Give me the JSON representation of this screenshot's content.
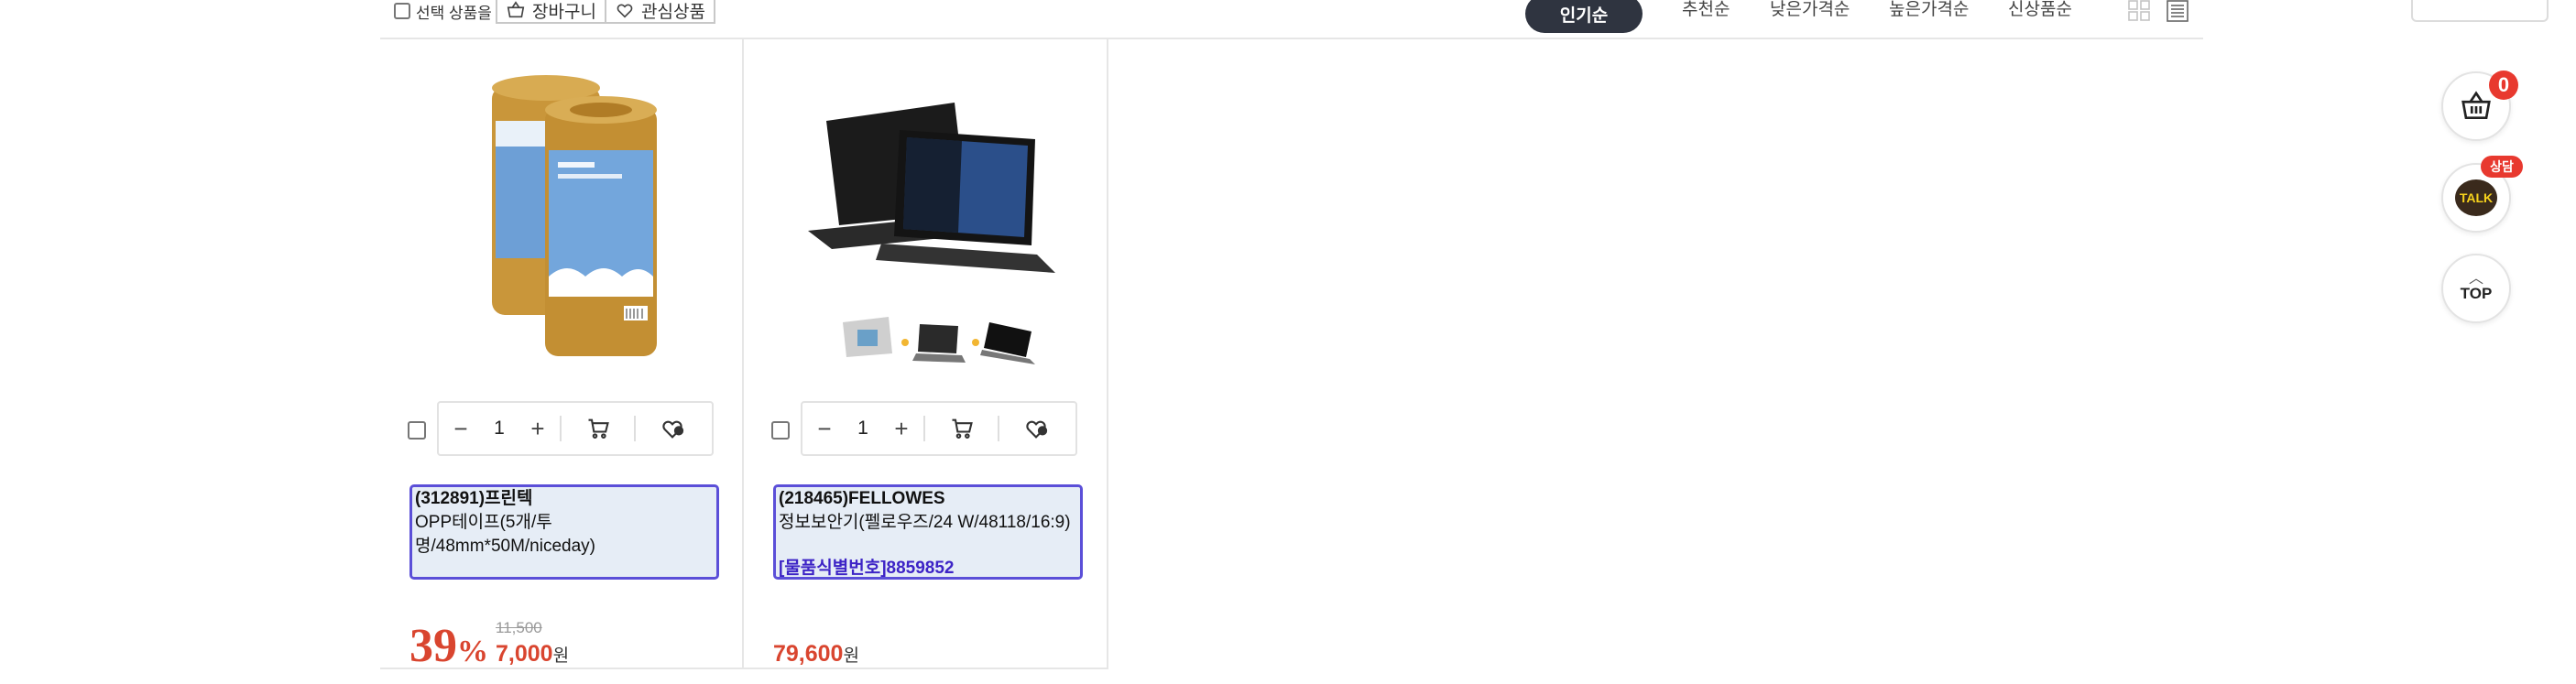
{
  "toolbar": {
    "select_label": "선택 상품을",
    "cart_label": "장바구니",
    "wish_label": "관심상품",
    "sort_active": "인기순",
    "sort_options": [
      "추천순",
      "낮은가격순",
      "높은가격순",
      "신상품순"
    ]
  },
  "products": [
    {
      "image": "packing-tape-rolls",
      "quantity": "1",
      "code": "(312891)프린텍",
      "name": "OPP테이프(5개/투명/48mm*50M/niceday)",
      "discount": "39",
      "discount_unit": "%",
      "original_price": "11,500",
      "price": "7,000",
      "currency": "원"
    },
    {
      "image": "laptop-privacy-filter",
      "quantity": "1",
      "code": "(218465)FELLOWES",
      "name": "정보보안기(펠로우즈/24 W/48118/16:9)",
      "item_id": "[물품식별번호]8859852",
      "price": "79,600",
      "currency": "원"
    }
  ],
  "floating": {
    "cart_count": "0",
    "talk_badge": "상담",
    "talk_label": "TALK",
    "top_label": "TOP"
  },
  "colors": {
    "sale_red": "#d9452f",
    "highlight_border": "#5b4fd8",
    "highlight_bg": "#e6edf6",
    "item_id_blue": "#3d24c6",
    "sort_active_bg": "#2f3440"
  }
}
